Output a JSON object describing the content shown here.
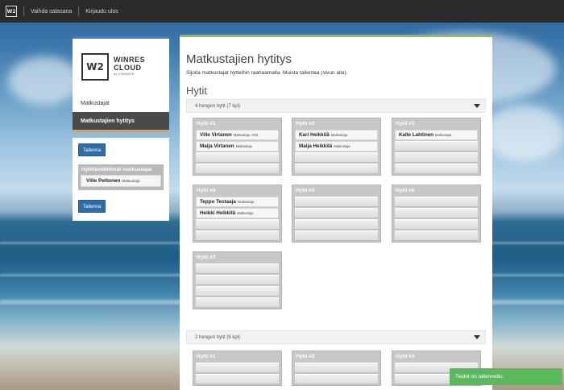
{
  "topbar": {
    "logo": "W2",
    "change_password": "Vaihda salasana",
    "logout": "Kirjaudu ulos"
  },
  "brand": {
    "mark": "W2",
    "line1": "WINRES",
    "line2": "CLOUD",
    "line3": "by COMGATE"
  },
  "sidebar": {
    "items": [
      {
        "label": "Matkustajat"
      },
      {
        "label": "Matkustajien hytitys"
      }
    ],
    "save_label": "Tallenna",
    "unassigned_title": "Hytittämättömät matkustajat",
    "unassigned": [
      {
        "name": "Ville Peltonen",
        "role": "Matkustaja"
      }
    ]
  },
  "main": {
    "title": "Matkustajien hytitys",
    "subtitle": "Sijoita matkustajat hytteihin raahaamalla. Muista tallentaa (sivun alla).",
    "section": "Hytit",
    "groups": [
      {
        "label": "4 hengen hytit (7 kpl)",
        "cabins": [
          {
            "title": "Hytti #1",
            "occupants": [
              {
                "name": "Ville Virtanen",
                "role": "Matkustaja, Vmk"
              },
              {
                "name": "Maija Virtanen",
                "role": "Matkustaja"
              }
            ]
          },
          {
            "title": "Hytti #2",
            "occupants": [
              {
                "name": "Kari Heikkilä",
                "role": "Matkustaja"
              },
              {
                "name": "Maija Heikkilä",
                "role": "Matkustaja"
              }
            ]
          },
          {
            "title": "Hytti #3",
            "occupants": [
              {
                "name": "Kalle Lahtinen",
                "role": "Matkustaja"
              }
            ]
          },
          {
            "title": "Hytti #4",
            "occupants": [
              {
                "name": "Teppo Testaaja",
                "role": "Matkustaja"
              },
              {
                "name": "Heikki Heikkilä",
                "role": "Matkustaja"
              }
            ]
          },
          {
            "title": "Hytti #5",
            "occupants": []
          },
          {
            "title": "Hytti #6",
            "occupants": []
          },
          {
            "title": "Hytti #7",
            "occupants": []
          }
        ]
      },
      {
        "label": "2 hengen hytit (6 kpl)",
        "cabins": [
          {
            "title": "Hytti #1",
            "occupants": []
          },
          {
            "title": "Hytti #2",
            "occupants": []
          },
          {
            "title": "Hytti #3",
            "occupants": []
          }
        ]
      }
    ]
  },
  "toast": "Tiedot on tallennettu.",
  "colors": {
    "topbar": "#2b2b2b",
    "accent_blue": "#2f6da7",
    "main_accent": "#8bbe4b",
    "toast": "#5cb85c",
    "cabin_bg": "#c7c7c7"
  }
}
